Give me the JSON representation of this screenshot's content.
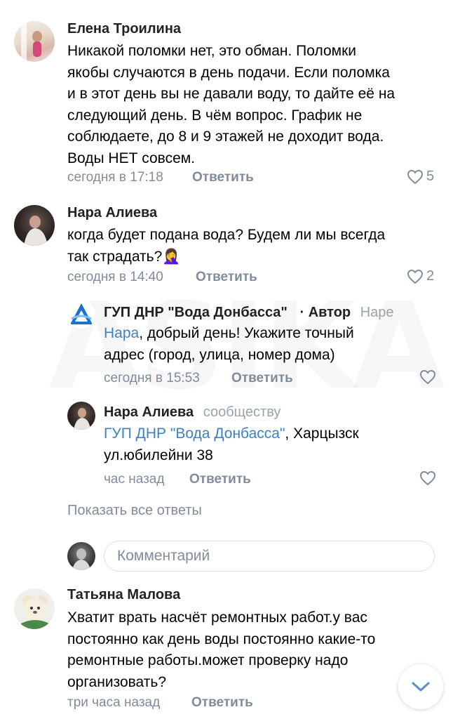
{
  "comments": [
    {
      "author": "Елена Троилина",
      "text_lines": [
        "Никакой поломки нет, это обман. Поломки",
        "якобы случаются в день подачи. Если поломка",
        "и в этот день вы не давали воду, то дайте её на",
        "следующий день. В чём вопрос. График не",
        "соблюдаете, до 8 и 9 этажей не доходит вода.",
        "Воды НЕТ совсем."
      ],
      "time": "сегодня в 17:18",
      "reply_label": "Ответить",
      "likes": "5"
    },
    {
      "author": "Нара Алиева",
      "text_lines": [
        "когда будет подана вода? Будем ли мы всегда",
        "так страдать?"
      ],
      "emoji": "🤦‍♀️",
      "time": "сегодня в 14:40",
      "reply_label": "Ответить",
      "likes": "2",
      "replies": [
        {
          "author": "ГУП ДНР \"Вода Донбасса\"",
          "author_tag": "· Автор",
          "to": "Наре",
          "mention": "Нара",
          "text_line1_rest": ", добрый день! Укажите точный",
          "text_line2": "адрес (город, улица, номер дома)",
          "time": "сегодня в 15:53",
          "reply_label": "Ответить"
        },
        {
          "author": "Нара Алиева",
          "to": "сообществу",
          "mention": "ГУП ДНР \"Вода Донбасса\"",
          "text_line1_rest": ", Харцызск",
          "text_line2": "ул.юбилейни 38",
          "time": "час назад",
          "reply_label": "Ответить"
        }
      ],
      "show_all_replies": "Показать все ответы"
    },
    {
      "author": "Татьяна Малова",
      "text_lines": [
        "Хватит врать насчёт ремонтных работ.у вас",
        "постоянно как день воды постоянно какие-то",
        "ремонтные работы.может проверку надо",
        "организовать?"
      ],
      "time": "три часа назад",
      "reply_label": "Ответить"
    }
  ],
  "comment_input": {
    "placeholder": "Комментарий"
  },
  "watermark": "ASIKA",
  "colors": {
    "link": "#3f7fc4",
    "meta": "#818c99",
    "vk_blue": "#1a73c9"
  },
  "icons": [
    "heart-icon",
    "chevron-down-icon",
    "vk-logo-icon"
  ]
}
